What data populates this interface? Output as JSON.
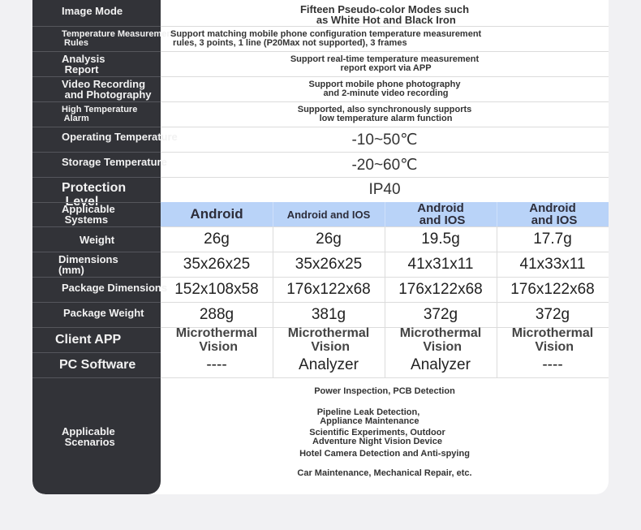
{
  "rows": {
    "image_mode": {
      "label": "Image Mode",
      "value": "Fifteen Pseudo-color Modes such\n as White Hot and Black Iron"
    },
    "temp_rules": {
      "label": "Temperature Measurement\n Rules",
      "value": "Support matching mobile phone configuration temperature measurement\n rules, 3 points, 1 line (P20Max not supported), 3 frames"
    },
    "analysis_report": {
      "label": "Analysis\n Report",
      "value": "Support real-time temperature measurement\n report export via APP"
    },
    "video_recording": {
      "label": "Video Recording\n and Photography",
      "value": "Support mobile phone photography\n and 2-minute video recording"
    },
    "high_temp_alarm": {
      "label": "High Temperature\n Alarm",
      "value": "Supported, also synchronously supports\n low temperature alarm function"
    },
    "operating_temp": {
      "label": "Operating Temperature",
      "value": "-10~50℃"
    },
    "storage_temp": {
      "label": "Storage Temperature",
      "value": "-20~60℃"
    },
    "protection_level": {
      "label": "Protection\n Level",
      "value": "IP40"
    },
    "applicable_systems": {
      "label": "Applicable\n Systems",
      "cells": [
        "Android",
        "Android and IOS",
        "Android\n and IOS",
        "Android\n and IOS"
      ]
    },
    "weight": {
      "label": "Weight",
      "cells": [
        "26g",
        "26g",
        "19.5g",
        "17.7g"
      ]
    },
    "dimensions": {
      "label": "Dimensions\n(mm)",
      "cells": [
        "35x26x25",
        "35x26x25",
        "41x31x11",
        "41x33x11"
      ]
    },
    "package_dimensions": {
      "label": "Package Dimensions",
      "cells": [
        "152x108x58",
        "176x122x68",
        "176x122x68",
        "176x122x68"
      ]
    },
    "package_weight": {
      "label": "Package Weight",
      "cells": [
        "288g",
        "381g",
        "372g",
        "372g"
      ]
    },
    "client_app": {
      "label": "Client APP",
      "cells": [
        "Microthermal\n Vision",
        "Microthermal\n Vision",
        "Microthermal\n Vision",
        "Microthermal\n Vision"
      ]
    },
    "pc_software": {
      "label": "PC Software",
      "cells": [
        "----",
        "Analyzer",
        "Analyzer",
        "----"
      ]
    },
    "applicable_scenarios": {
      "label": "Applicable\n Scenarios",
      "items": [
        "Power Inspection, PCB Detection",
        "Pipeline Leak Detection,\n Appliance Maintenance",
        "Scientific Experiments, Outdoor\nAdventure Night Vision Device",
        "Hotel Camera Detection and Anti-spying",
        "Car Maintenance, Mechanical Repair, etc."
      ]
    }
  },
  "colors": {
    "sidebar": "#323338",
    "highlight": "#b9d3f8",
    "page": "#f1f1f3"
  }
}
